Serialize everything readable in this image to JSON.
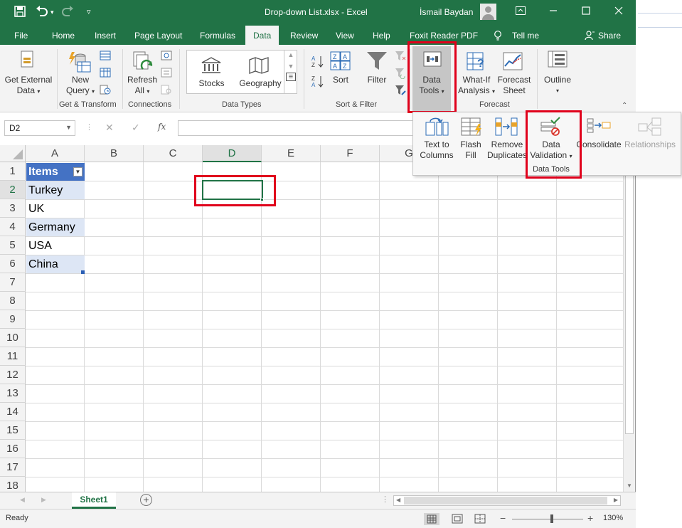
{
  "title_bar": {
    "file_title": "Drop-down List.xlsx  -  Excel",
    "user_name": "İsmail Baydan"
  },
  "tabs": [
    "File",
    "Home",
    "Insert",
    "Page Layout",
    "Formulas",
    "Data",
    "Review",
    "View",
    "Help",
    "Foxit Reader PDF",
    "Tell me",
    "Share"
  ],
  "active_tab": "Data",
  "ribbon": {
    "get_external_data": "Get External",
    "get_external_data2": "Data",
    "new_query": "New",
    "new_query2": "Query",
    "group_get_transform": "Get & Transform",
    "refresh": "Refresh",
    "refresh2": "All",
    "group_connections": "Connections",
    "stocks": "Stocks",
    "geography": "Geography",
    "group_data_types": "Data Types",
    "sort": "Sort",
    "filter": "Filter",
    "group_sort_filter": "Sort & Filter",
    "data_tools": "Data",
    "data_tools2": "Tools",
    "what_if": "What-If",
    "what_if2": "Analysis",
    "forecast_sheet": "Forecast",
    "forecast_sheet2": "Sheet",
    "group_forecast": "Forecast",
    "outline": "Outline"
  },
  "data_tools_panel": {
    "text_to_columns": "Text to",
    "text_to_columns2": "Columns",
    "flash_fill": "Flash",
    "flash_fill2": "Fill",
    "remove_duplicates": "Remove",
    "remove_duplicates2": "Duplicates",
    "data_validation": "Data",
    "data_validation2": "Validation",
    "consolidate": "Consolidate",
    "relationships": "Relationships",
    "group_label": "Data Tools"
  },
  "formula_bar": {
    "name_box": "D2",
    "fx": "fx",
    "content": ""
  },
  "columns": [
    "A",
    "B",
    "C",
    "D",
    "E",
    "F",
    "G"
  ],
  "selected_column": "D",
  "rows": [
    "1",
    "2",
    "3",
    "4",
    "5",
    "6",
    "7",
    "8",
    "9",
    "10",
    "11",
    "12",
    "13",
    "14",
    "15",
    "16",
    "17",
    "18"
  ],
  "table": {
    "header": "Items",
    "items": [
      "Turkey",
      "UK",
      "Germany",
      "USA",
      "China"
    ]
  },
  "sheet_tab": "Sheet1",
  "status": {
    "ready": "Ready",
    "zoom": "130%"
  }
}
